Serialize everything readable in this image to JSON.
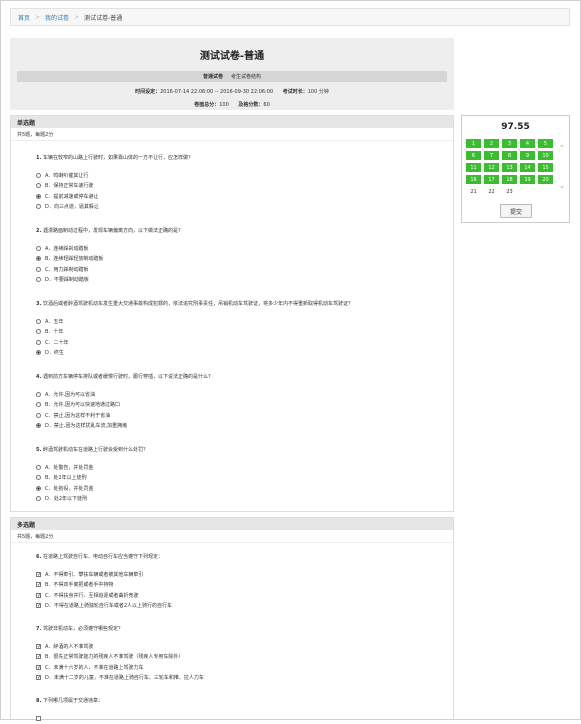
{
  "breadcrumb": {
    "home": "首页",
    "my_exams": "我的试卷",
    "current": "测试试卷-普通"
  },
  "exam": {
    "title": "测试试卷-普通",
    "type": "普通试卷",
    "subtitle": "考生试卷结构",
    "time_label": "时间设定：",
    "time_value": "2016-07-14 22:06:00 -- 2016-09-30 22:06:00",
    "duration_label": "考试时长：",
    "duration_value": "100 分钟",
    "total_label": "卷面总分：",
    "total_value": "100",
    "pass_label": "及格分数：",
    "pass_value": "60"
  },
  "single": {
    "title": "单选题",
    "summary": "共5题，每题2分",
    "questions": [
      {
        "num": "1.",
        "text": "车辆在较窄的山路上行驶时，如果靠山体的一方不让行，应怎样做？",
        "options": [
          "A．鸣喇叭催其让行",
          "B．保持正常车速行驶",
          "C．提前减速或停车避让",
          "D．向三点道，逼其躲让"
        ],
        "selected": 2
      },
      {
        "num": "2.",
        "text": "遇漫路面制动过程中，发现车辆偏离方向，以下做法正确的是？",
        "options": [
          "A．连续踩刹动踏板",
          "B．连续轻踩轻放制动踏板",
          "C．用力踩制动踏板",
          "D．不要踩制动踏板"
        ],
        "selected": 1
      },
      {
        "num": "3.",
        "text": "饮酒后或者醉酒驾驶机动车发生重大交通事故构成犯罪的，依法追究刑事责任，吊销机动车驾驶证，将多少年内不得重新取得机动车驾驶证？",
        "options": [
          "A．五年",
          "B．十年",
          "C．二十年",
          "D．终生"
        ],
        "selected": 3
      },
      {
        "num": "4.",
        "text": "遇到前方车辆停车排队或者缓慢行驶时，跟行穿插，以下说法正确的是什么？",
        "options": [
          "A．允许,因为可以省油",
          "B．允许,因为可以快速地通过路口",
          "C．禁止,因为这样不利于省油",
          "D．禁止,因为这样扰乱车流,加重拥堵"
        ],
        "selected": 3
      },
      {
        "num": "5.",
        "text": "醉酒驾驶机动车在道路上行驶会受到什么处罚？",
        "options": [
          "A．处警告，并处罚金",
          "B．处2年以上徒刑",
          "C．处拘役，并处罚金",
          "D．处2年以下徒刑"
        ],
        "selected": 2
      }
    ]
  },
  "multi": {
    "title": "多选题",
    "summary": "共5题，每题2分",
    "questions": [
      {
        "num": "6.",
        "text": "在道路上驾驶自行车、电动自行车应当遵守下列规定：",
        "options": [
          "A．不得牵引、攀扶车辆或者被其他车辆牵引",
          "B．不得双手离把或者手中持物",
          "C．不得扶身并行、互相追逐或者曲折竞驶",
          "D．不得在道路上骑独轮自行车或者2人以上骑行的自行车"
        ]
      },
      {
        "num": "7.",
        "text": "驾驶非机动车，必须遵守哪些规定？",
        "options": [
          "A．醉酒的人不准驾驶",
          "B．很先正常驾驶能力的残疾人不准驾驶（残疾人专用车除外）",
          "C．未满十六岁的人，不准在道路上驾驶力车",
          "D．未满十二岁的儿童，不准在道路上骑自行车、三轮车和推、拉人力车"
        ]
      },
      {
        "num": "8.",
        "text": "下列哪几项属于交通违章："
      }
    ]
  },
  "sidebar": {
    "score": "97.55",
    "grid": [
      "1",
      "2",
      "3",
      "4",
      "5",
      "6",
      "7",
      "8",
      "9",
      "10",
      "11",
      "12",
      "13",
      "14",
      "15",
      "16",
      "17",
      "18",
      "19",
      "20",
      "21",
      "22",
      "23"
    ],
    "answered_count": 20,
    "submit": "提交"
  }
}
